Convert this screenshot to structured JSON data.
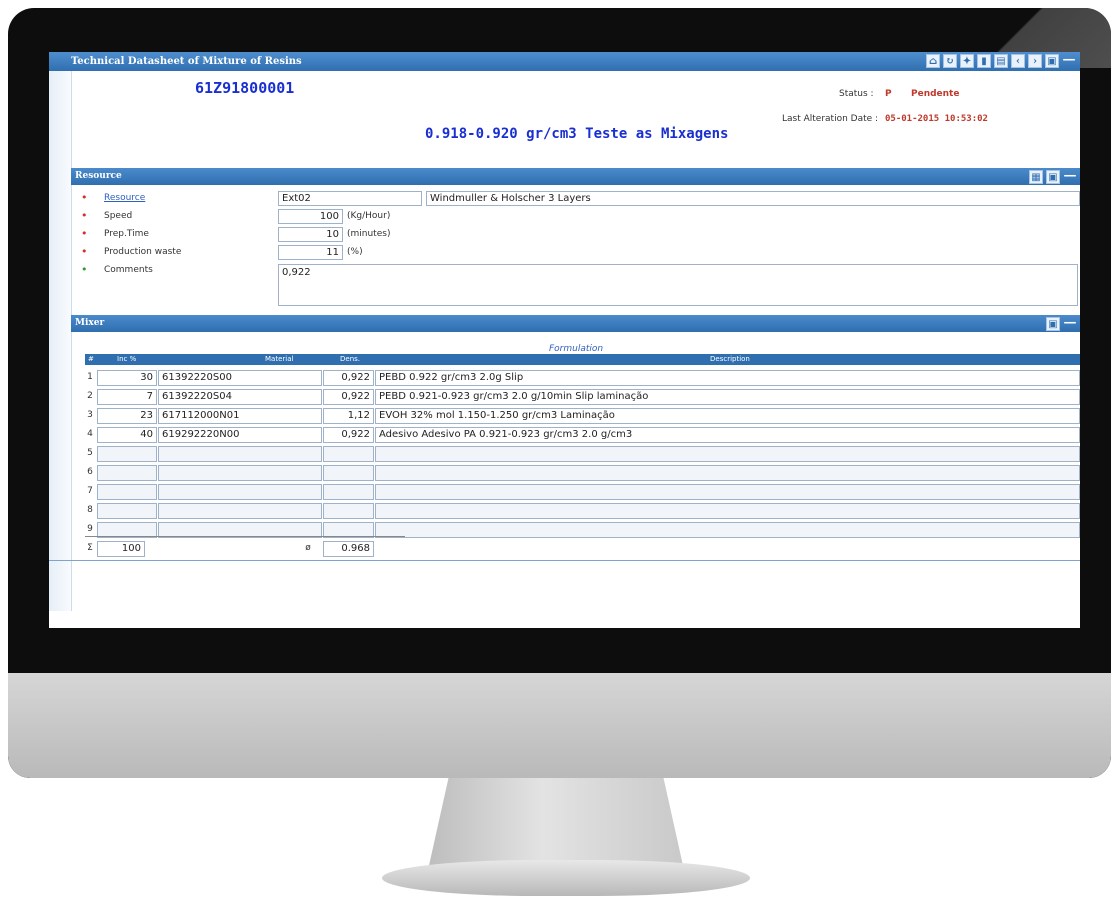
{
  "window": {
    "title": "Technical Datasheet of Mixture of Resins",
    "toolbar_icons": [
      "home-icon",
      "refresh-icon",
      "pin-icon",
      "document-icon",
      "print-icon",
      "prev-icon",
      "next-icon",
      "save-icon",
      "minimize-icon"
    ]
  },
  "header": {
    "code": "61Z91800001",
    "status_label": "Status :",
    "status_code": "P",
    "status_text": "Pendente",
    "alteration_label": "Last Alteration Date :",
    "alteration_date": "05-01-2015 10:53:02",
    "title": "0.918-0.920 gr/cm3 Teste as Mixagens"
  },
  "resource": {
    "section_label": "Resource",
    "resource_label": "Resource",
    "resource_code": "Ext02",
    "resource_name": "Windmuller & Holscher 3 Layers",
    "speed_label": "Speed",
    "speed_value": "100",
    "speed_unit": "(Kg/Hour)",
    "prep_label": "Prep.Time",
    "prep_value": "10",
    "prep_unit": "(minutes)",
    "waste_label": "Production waste",
    "waste_value": "11",
    "waste_unit": "(%)",
    "comments_label": "Comments",
    "comments_value": "0,922"
  },
  "mixer": {
    "section_label": "Mixer",
    "caption": "Formulation",
    "columns": [
      "#",
      "Inc %",
      "Material",
      "Dens.",
      "Description"
    ],
    "rows": [
      {
        "n": "1",
        "inc": "30",
        "material": "61392220S00",
        "dens": "0,922",
        "desc": "PEBD 0.922 gr/cm3 2.0g Slip"
      },
      {
        "n": "2",
        "inc": "7",
        "material": "61392220S04",
        "dens": "0,922",
        "desc": "PEBD 0.921-0.923 gr/cm3 2.0 g/10min Slip laminação"
      },
      {
        "n": "3",
        "inc": "23",
        "material": "617112000N01",
        "dens": "1,12",
        "desc": "EVOH 32% mol 1.150-1.250 gr/cm3 Laminação"
      },
      {
        "n": "4",
        "inc": "40",
        "material": "619292220N00",
        "dens": "0,922",
        "desc": "Adesivo Adesivo PA 0.921-0.923 gr/cm3 2.0 g/cm3"
      },
      {
        "n": "5",
        "inc": "",
        "material": "",
        "dens": "",
        "desc": ""
      },
      {
        "n": "6",
        "inc": "",
        "material": "",
        "dens": "",
        "desc": ""
      },
      {
        "n": "7",
        "inc": "",
        "material": "",
        "dens": "",
        "desc": ""
      },
      {
        "n": "8",
        "inc": "",
        "material": "",
        "dens": "",
        "desc": ""
      },
      {
        "n": "9",
        "inc": "",
        "material": "",
        "dens": "",
        "desc": ""
      }
    ],
    "sum_symbol": "Σ",
    "sum_value": "100",
    "avg_symbol": "ø",
    "avg_value": "0.968"
  }
}
